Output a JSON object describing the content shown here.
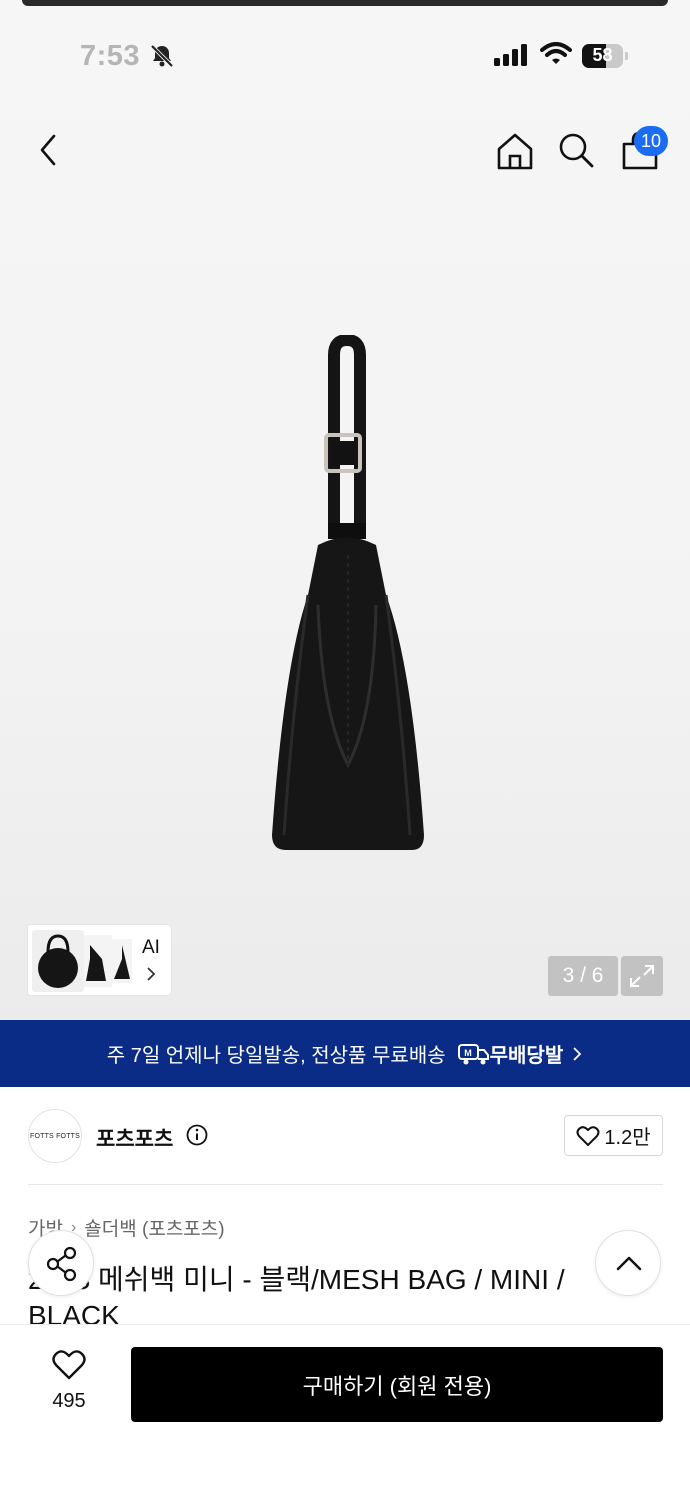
{
  "status_bar": {
    "time": "7:53",
    "battery_percent": "58",
    "battery_level": 0.58
  },
  "header": {
    "cart_count": "10"
  },
  "gallery": {
    "ai_label": "AI",
    "counter": "3 / 6"
  },
  "banner": {
    "text": "주 7일 언제나 당일발송, 전상품 무료배송",
    "logo_text": "무배당발"
  },
  "brand": {
    "logo_text": "FOTTS FOTTS",
    "name": "포츠포츠",
    "likes": "1.2만"
  },
  "product": {
    "breadcrumb": [
      "가방",
      "숄더백 (포츠포츠)"
    ],
    "title": "2…S 메쉬백 미니 - 블랙/MESH BAG / MINI / BLACK"
  },
  "bottom_bar": {
    "wish_count": "495",
    "buy_label": "구매하기 (회원 전용)"
  },
  "icons": [
    "bell-slash-icon",
    "signal-icon",
    "wifi-icon",
    "battery-icon",
    "back-icon",
    "home-icon",
    "search-icon",
    "cart-icon",
    "chevron-right-icon",
    "expand-icon",
    "delivery-truck-icon",
    "info-icon",
    "heart-icon",
    "share-icon",
    "chevron-up-icon"
  ],
  "colors": {
    "banner_bg": "#0a2c87",
    "badge": "#1a6cf2",
    "buy_button": "#000000"
  }
}
